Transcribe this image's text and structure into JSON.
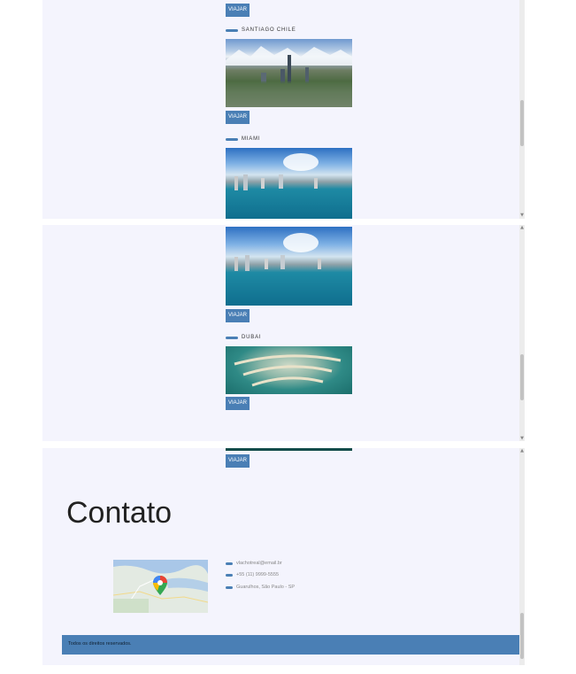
{
  "panel1": {
    "buttons": [
      "VIAJAR",
      "VIAJAR"
    ],
    "destinations": [
      "SANTIAGO CHILE",
      "MIAMI"
    ]
  },
  "panel2": {
    "buttons": [
      "VIAJAR",
      "VIAJAR"
    ],
    "destinations": [
      "DUBAI"
    ]
  },
  "panel3": {
    "button": "VIAJAR",
    "heading": "Contato",
    "contacts": [
      {
        "icon": "email-icon",
        "text": "vlachotreal@email.br"
      },
      {
        "icon": "phone-icon",
        "text": "+55 (11) 9999-5555"
      },
      {
        "icon": "location-icon",
        "text": "Guarulhos, São Paulo - SP"
      }
    ],
    "map_icon": "map-pin-icon",
    "footer": "Todos os direitos reservados."
  },
  "colors": {
    "accent": "#4a7fb5",
    "panel_bg": "#f4f4fd"
  }
}
